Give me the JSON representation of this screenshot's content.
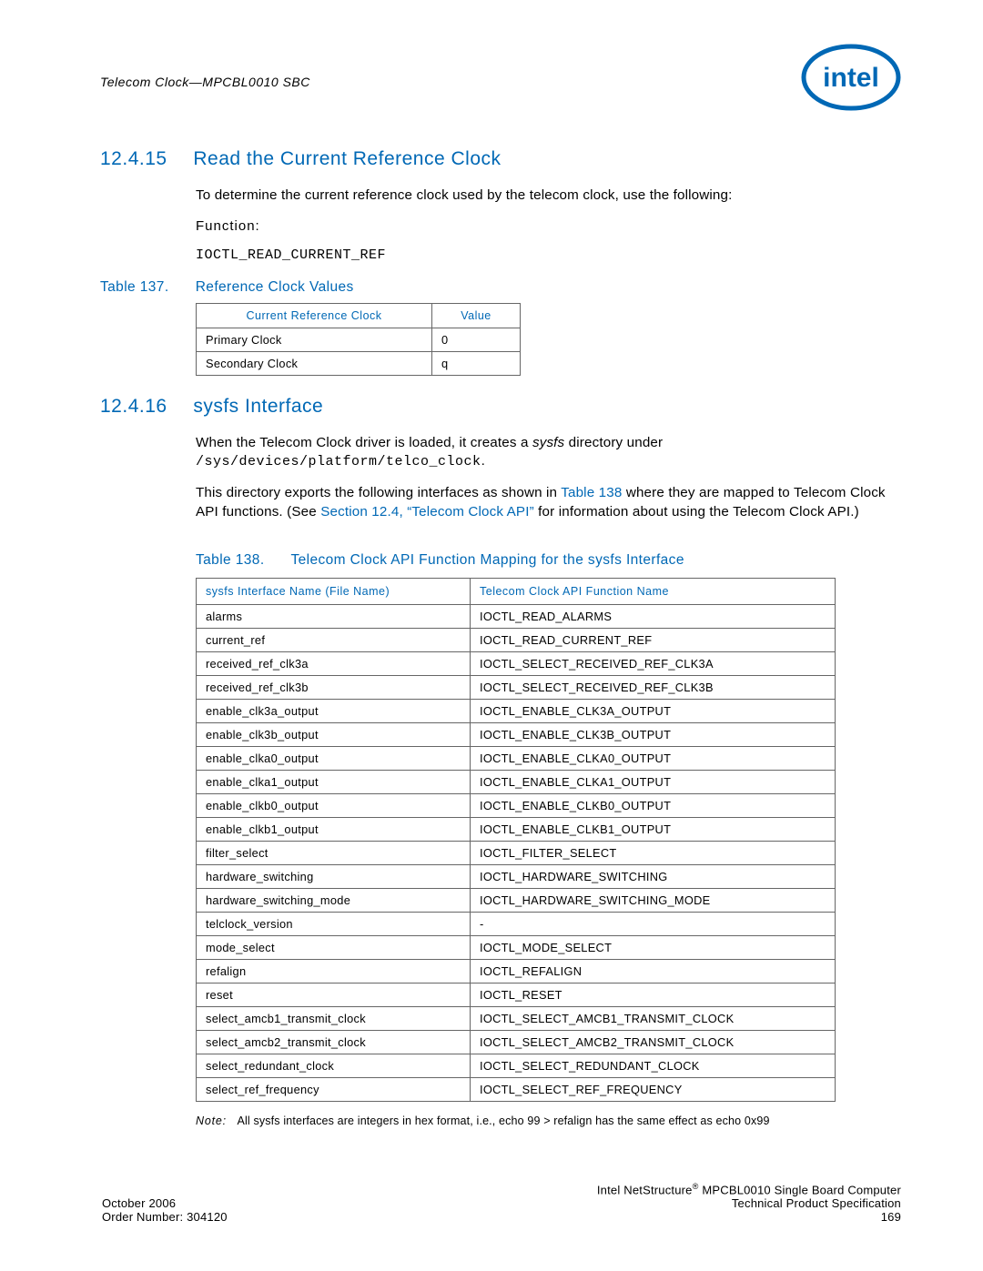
{
  "header": {
    "doc_title": "Telecom Clock—MPCBL0010 SBC",
    "logo_label": "intel"
  },
  "section_15": {
    "number": "12.4.15",
    "title": "Read the Current Reference Clock",
    "intro": "To determine the current reference clock used by the telecom clock, use the following:",
    "function_label": "Function:",
    "function_code": "IOCTL_READ_CURRENT_REF"
  },
  "table137": {
    "caption_num": "Table 137.",
    "caption_title": "Reference Clock Values",
    "col1": "Current Reference Clock",
    "col2": "Value",
    "rows": [
      {
        "c1": "Primary Clock",
        "c2": "0"
      },
      {
        "c1": "Secondary Clock",
        "c2": "q"
      }
    ]
  },
  "section_16": {
    "number": "12.4.16",
    "title": "sysfs Interface",
    "para1_a": "When the Telecom Clock driver is loaded, it creates a ",
    "para1_em": "sysfs",
    "para1_b": " directory under ",
    "para1_path": "/sys/devices/platform/telco_clock",
    "para1_c": ".",
    "para2_a": "This directory exports the following interfaces as shown in ",
    "para2_link1": "Table 138",
    "para2_b": " where they are mapped to Telecom Clock API functions. (See ",
    "para2_link2": "Section 12.4, “Telecom Clock API”",
    "para2_c": " for information about using the Telecom Clock API.)"
  },
  "table138": {
    "caption_num": "Table 138.",
    "caption_title": "Telecom Clock API Function Mapping for the sysfs Interface",
    "col1": "sysfs Interface Name (File Name)",
    "col2": "Telecom Clock API Function Name",
    "rows": [
      {
        "c1": "alarms",
        "c2": "IOCTL_READ_ALARMS"
      },
      {
        "c1": "current_ref",
        "c2": "IOCTL_READ_CURRENT_REF"
      },
      {
        "c1": "received_ref_clk3a",
        "c2": "IOCTL_SELECT_RECEIVED_REF_CLK3A"
      },
      {
        "c1": "received_ref_clk3b",
        "c2": "IOCTL_SELECT_RECEIVED_REF_CLK3B"
      },
      {
        "c1": "enable_clk3a_output",
        "c2": "IOCTL_ENABLE_CLK3A_OUTPUT"
      },
      {
        "c1": "enable_clk3b_output",
        "c2": "IOCTL_ENABLE_CLK3B_OUTPUT"
      },
      {
        "c1": "enable_clka0_output",
        "c2": "IOCTL_ENABLE_CLKA0_OUTPUT"
      },
      {
        "c1": "enable_clka1_output",
        "c2": "IOCTL_ENABLE_CLKA1_OUTPUT"
      },
      {
        "c1": "enable_clkb0_output",
        "c2": "IOCTL_ENABLE_CLKB0_OUTPUT"
      },
      {
        "c1": "enable_clkb1_output",
        "c2": "IOCTL_ENABLE_CLKB1_OUTPUT"
      },
      {
        "c1": "filter_select",
        "c2": "IOCTL_FILTER_SELECT"
      },
      {
        "c1": "hardware_switching",
        "c2": "IOCTL_HARDWARE_SWITCHING"
      },
      {
        "c1": "hardware_switching_mode",
        "c2": "IOCTL_HARDWARE_SWITCHING_MODE"
      },
      {
        "c1": "telclock_version",
        "c2": "-"
      },
      {
        "c1": "mode_select",
        "c2": "IOCTL_MODE_SELECT"
      },
      {
        "c1": "refalign",
        "c2": "IOCTL_REFALIGN"
      },
      {
        "c1": "reset",
        "c2": "IOCTL_RESET"
      },
      {
        "c1": "select_amcb1_transmit_clock",
        "c2": "IOCTL_SELECT_AMCB1_TRANSMIT_CLOCK"
      },
      {
        "c1": "select_amcb2_transmit_clock",
        "c2": "IOCTL_SELECT_AMCB2_TRANSMIT_CLOCK"
      },
      {
        "c1": "select_redundant_clock",
        "c2": "IOCTL_SELECT_REDUNDANT_CLOCK"
      },
      {
        "c1": "select_ref_frequency",
        "c2": "IOCTL_SELECT_REF_FREQUENCY"
      }
    ]
  },
  "note": {
    "label": "Note:",
    "text": "All sysfs interfaces are integers in hex format, i.e., echo 99 > refalign has the same effect as echo 0x99"
  },
  "footer": {
    "left_line1": "October 2006",
    "left_line2": "Order Number: 304120",
    "right_line1a": "Intel NetStructure",
    "right_line1b": " MPCBL0010 Single Board Computer",
    "right_line2": "Technical Product Specification",
    "right_line3": "169"
  }
}
